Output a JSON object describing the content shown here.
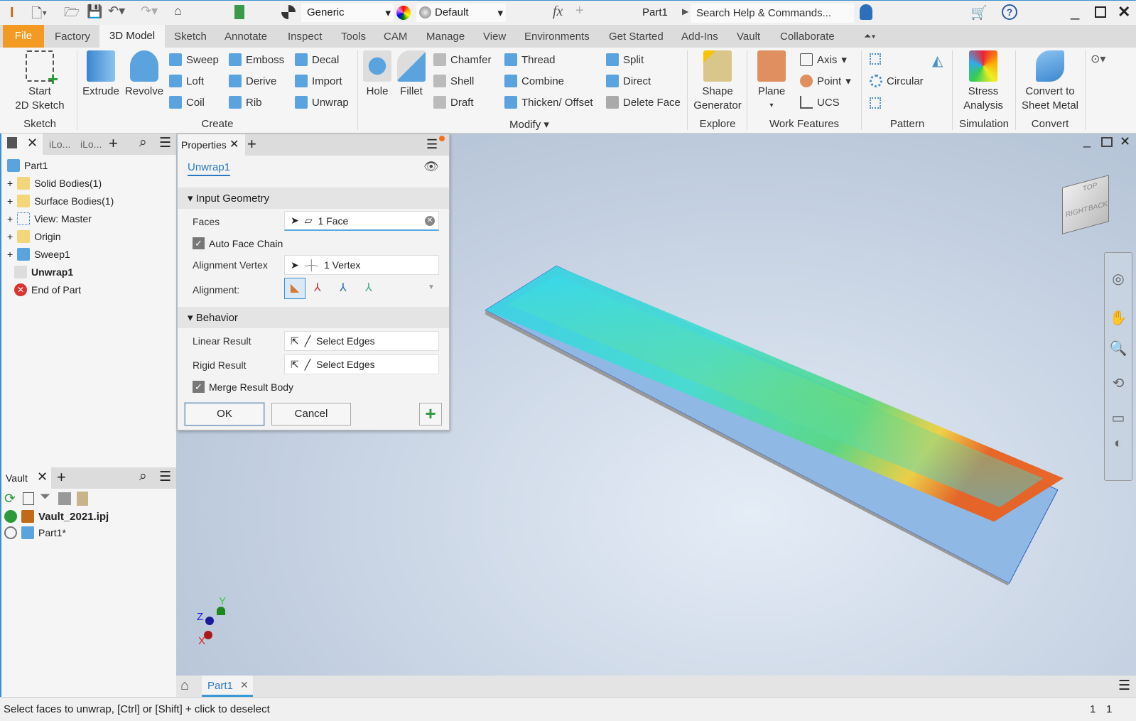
{
  "titlebar": {
    "material": "Generic",
    "appearance": "Default",
    "fx": "fx",
    "doc": "Part1",
    "search_placeholder": "Search Help & Commands..."
  },
  "tabs": [
    "File",
    "Factory",
    "3D Model",
    "Sketch",
    "Annotate",
    "Inspect",
    "Tools",
    "CAM",
    "Manage",
    "View",
    "Environments",
    "Get Started",
    "Add-Ins",
    "Vault",
    "Collaborate"
  ],
  "ribbon": {
    "sketch": {
      "start": "Start",
      "start2": "2D Sketch",
      "group": "Sketch"
    },
    "create": {
      "extrude": "Extrude",
      "revolve": "Revolve",
      "sweep": "Sweep",
      "loft": "Loft",
      "coil": "Coil",
      "emboss": "Emboss",
      "derive": "Derive",
      "rib": "Rib",
      "decal": "Decal",
      "import": "Import",
      "unwrap": "Unwrap",
      "group": "Create"
    },
    "modify": {
      "hole": "Hole",
      "fillet": "Fillet",
      "chamfer": "Chamfer",
      "shell": "Shell",
      "draft": "Draft",
      "thread": "Thread",
      "combine": "Combine",
      "thicken": "Thicken/ Offset",
      "split": "Split",
      "direct": "Direct",
      "delete_face": "Delete Face",
      "group": "Modify"
    },
    "explore": {
      "shape": "Shape",
      "generator": "Generator",
      "group": "Explore"
    },
    "work": {
      "plane": "Plane",
      "axis": "Axis",
      "point": "Point",
      "ucs": "UCS",
      "group": "Work Features"
    },
    "pattern": {
      "circular": "Circular",
      "group": "Pattern"
    },
    "simulation": {
      "stress": "Stress",
      "analysis": "Analysis",
      "group": "Simulation"
    },
    "convert": {
      "c1": "Convert to",
      "c2": "Sheet Metal",
      "group": "Convert"
    }
  },
  "browser": {
    "tab1": "iLo...",
    "tab2": "iLo...",
    "items": [
      "Part1",
      "Solid Bodies(1)",
      "Surface Bodies(1)",
      "View: Master",
      "Origin",
      "Sweep1",
      "Unwrap1",
      "End of Part"
    ]
  },
  "vault": {
    "tab": "Vault",
    "project": "Vault_2021.ipj",
    "part": "Part1*"
  },
  "properties": {
    "tab": "Properties",
    "feature": "Unwrap1",
    "input_geometry": "Input Geometry",
    "faces_label": "Faces",
    "faces_value": "1 Face",
    "auto_face_chain": "Auto Face Chain",
    "alignment_vertex_label": "Alignment Vertex",
    "alignment_vertex_value": "1 Vertex",
    "alignment_label": "Alignment:",
    "behavior": "Behavior",
    "linear_label": "Linear Result",
    "linear_value": "Select Edges",
    "rigid_label": "Rigid Result",
    "rigid_value": "Select Edges",
    "merge": "Merge Result Body",
    "ok": "OK",
    "cancel": "Cancel",
    "auto_face_chain_checked": true,
    "merge_checked": true
  },
  "viewcube": {
    "top": "TOP",
    "right": "RIGHT",
    "back": "BACK"
  },
  "triad": {
    "x": "X",
    "y": "Y",
    "z": "Z"
  },
  "doctab": {
    "label": "Part1"
  },
  "status": {
    "message": "Select faces to unwrap, [Ctrl] or [Shift] + click to deselect",
    "n1": "1",
    "n2": "1"
  }
}
